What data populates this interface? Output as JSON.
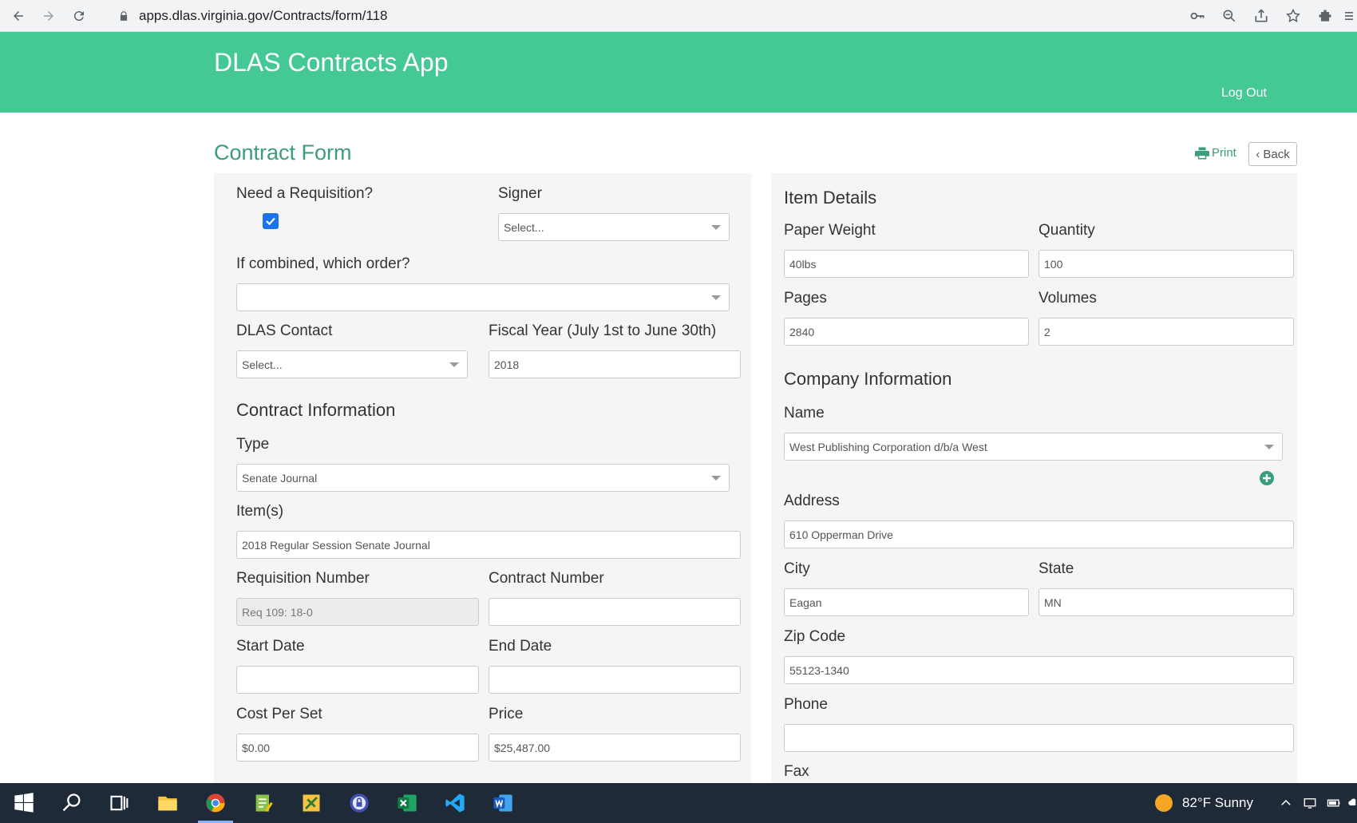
{
  "browser": {
    "url": "apps.dlas.virginia.gov/Contracts/form/118"
  },
  "header": {
    "app_title": "DLAS Contracts App",
    "logout_label": "Log Out"
  },
  "page": {
    "title": "Contract Form",
    "print_label": "Print",
    "back_label": "‹ Back"
  },
  "left": {
    "need_requisition_label": "Need a Requisition?",
    "need_requisition_checked": true,
    "signer_label": "Signer",
    "signer_value": "Select...",
    "combined_label": "If combined, which order?",
    "combined_value": "",
    "dlas_contact_label": "DLAS Contact",
    "dlas_contact_value": "Select...",
    "fiscal_year_label": "Fiscal Year (July 1st to June 30th)",
    "fiscal_year_value": "2018",
    "contract_info_heading": "Contract Information",
    "type_label": "Type",
    "type_value": "Senate Journal",
    "items_label": "Item(s)",
    "items_value": "2018 Regular Session Senate Journal",
    "req_number_label": "Requisition Number",
    "req_number_value": "Req 109: 18-0",
    "contract_number_label": "Contract Number",
    "contract_number_value": "",
    "start_date_label": "Start Date",
    "start_date_value": "",
    "end_date_label": "End Date",
    "end_date_value": "",
    "cost_per_set_label": "Cost Per Set",
    "cost_per_set_value": "$0.00",
    "price_label": "Price",
    "price_value": "$25,487.00"
  },
  "right": {
    "item_details_heading": "Item Details",
    "paper_weight_label": "Paper Weight",
    "paper_weight_value": "40lbs",
    "quantity_label": "Quantity",
    "quantity_value": "100",
    "pages_label": "Pages",
    "pages_value": "2840",
    "volumes_label": "Volumes",
    "volumes_value": "2",
    "company_info_heading": "Company Information",
    "name_label": "Name",
    "name_value": "West Publishing Corporation d/b/a West",
    "address_label": "Address",
    "address_value": "610 Opperman Drive",
    "city_label": "City",
    "city_value": "Eagan",
    "state_label": "State",
    "state_value": "MN",
    "zip_label": "Zip Code",
    "zip_value": "55123-1340",
    "phone_label": "Phone",
    "phone_value": "",
    "fax_label": "Fax"
  },
  "taskbar": {
    "weather": "82°F  Sunny"
  },
  "colors": {
    "header_bg": "#44c994",
    "accent_text": "#3a9e78",
    "panel_bg": "#f5f5f5",
    "taskbar_bg": "#1f2a38"
  },
  "icons": [
    "back-arrow-icon",
    "forward-arrow-icon",
    "reload-icon",
    "lock-icon",
    "key-icon",
    "zoom-icon",
    "share-icon",
    "star-icon",
    "extensions-icon",
    "printer-icon",
    "checkmark-icon",
    "plus-circle-icon",
    "windows-icon",
    "search-icon",
    "task-view-icon",
    "file-explorer-icon",
    "chrome-icon",
    "excel-icon",
    "vscode-icon",
    "word-icon"
  ]
}
